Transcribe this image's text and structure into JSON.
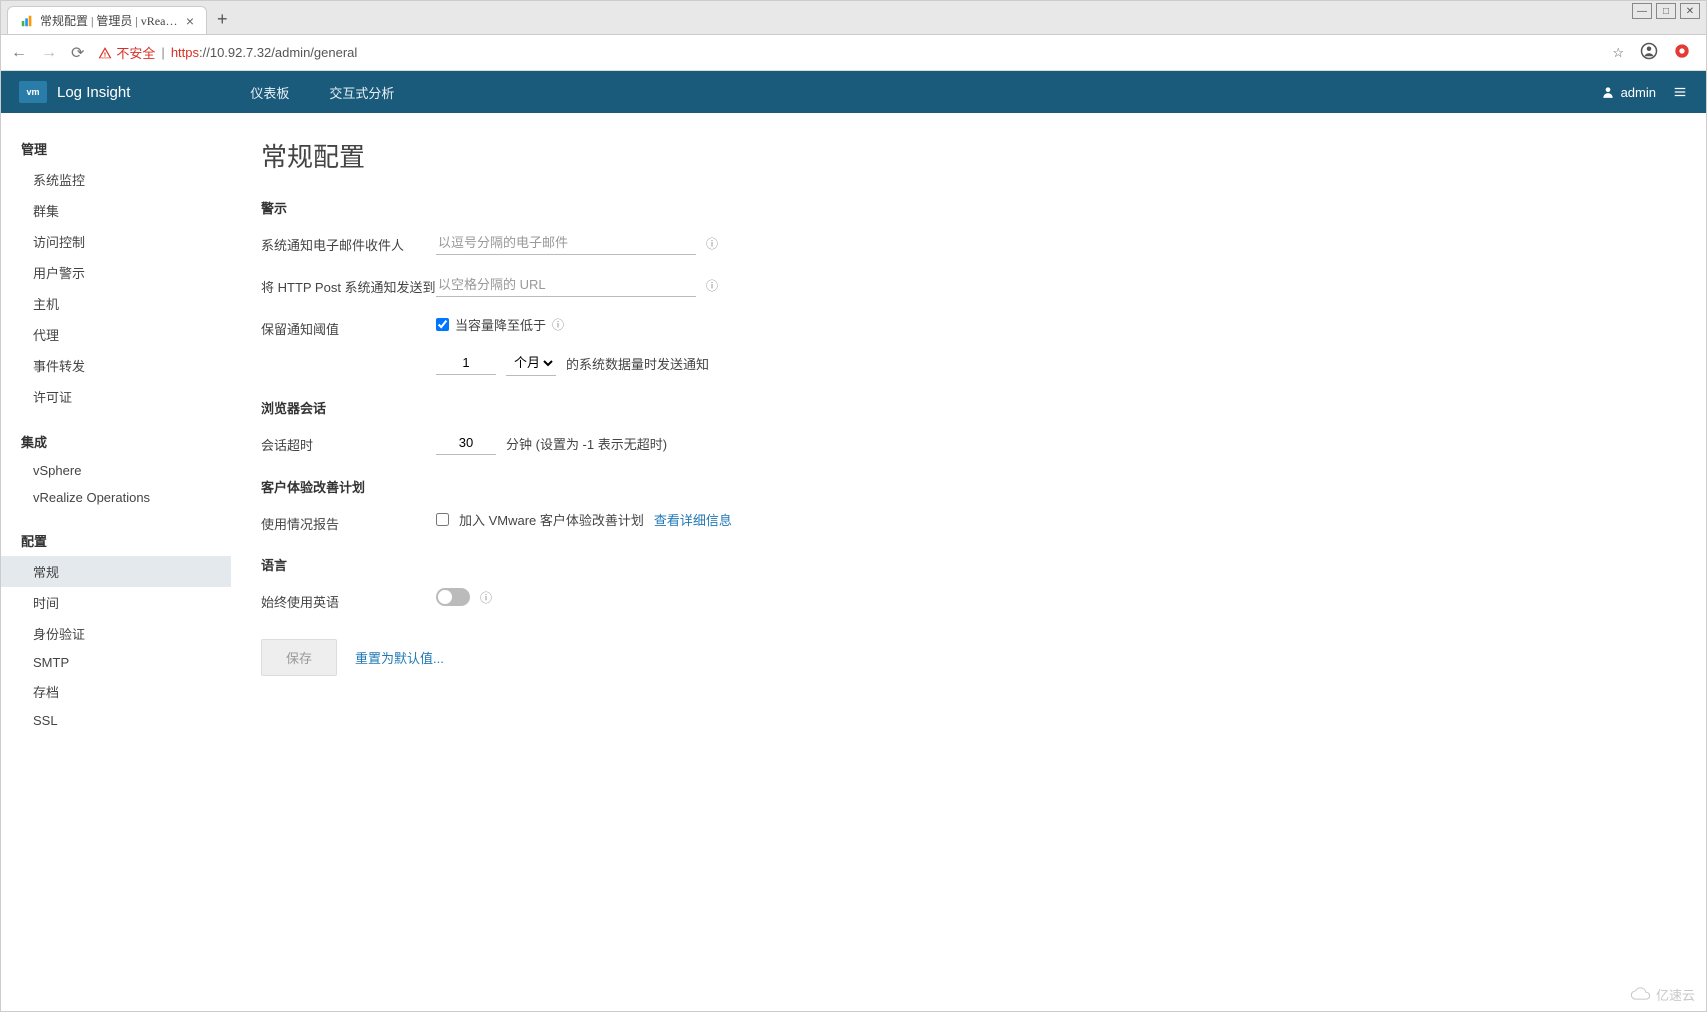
{
  "browser": {
    "tab_title": "常规配置 | 管理员 | vRealize",
    "insecure_label": "不安全",
    "url_https": "https",
    "url_rest": "://10.92.7.32/admin/general"
  },
  "header": {
    "logo_text": "vm",
    "app_title": "Log Insight",
    "nav_dashboard": "仪表板",
    "nav_interactive": "交互式分析",
    "user_label": "admin"
  },
  "sidebar": {
    "groups": [
      {
        "title": "管理",
        "items": [
          "系统监控",
          "群集",
          "访问控制",
          "用户警示",
          "主机",
          "代理",
          "事件转发",
          "许可证"
        ]
      },
      {
        "title": "集成",
        "items": [
          "vSphere",
          "vRealize Operations"
        ]
      },
      {
        "title": "配置",
        "items": [
          "常规",
          "时间",
          "身份验证",
          "SMTP",
          "存档",
          "SSL"
        ]
      }
    ],
    "active_item": "常规"
  },
  "page": {
    "title": "常规配置",
    "sections": {
      "alerts": {
        "title": "警示",
        "email_label": "系统通知电子邮件收件人",
        "email_placeholder": "以逗号分隔的电子邮件",
        "http_label": "将 HTTP Post 系统通知发送到",
        "http_placeholder": "以空格分隔的 URL",
        "threshold_label": "保留通知阈值",
        "threshold_checkbox_label": "当容量降至低于",
        "threshold_value": "1",
        "threshold_unit": "个月",
        "threshold_suffix": "的系统数据量时发送通知"
      },
      "session": {
        "title": "浏览器会话",
        "timeout_label": "会话超时",
        "timeout_value": "30",
        "timeout_suffix": "分钟 (设置为 -1 表示无超时)"
      },
      "ceip": {
        "title": "客户体验改善计划",
        "usage_label": "使用情况报告",
        "join_label": "加入 VMware 客户体验改善计划",
        "details_link": "查看详细信息"
      },
      "language": {
        "title": "语言",
        "english_label": "始终使用英语"
      }
    },
    "buttons": {
      "save": "保存",
      "reset": "重置为默认值..."
    }
  },
  "watermark": "亿速云"
}
